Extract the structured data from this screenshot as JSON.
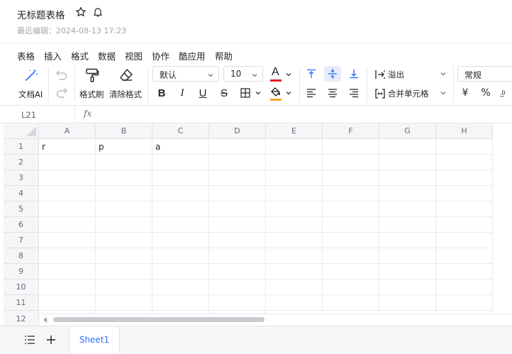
{
  "document": {
    "title": "无标题表格",
    "last_edit": "最近编辑：2024-08-13 17:23"
  },
  "menu": [
    "表格",
    "插入",
    "格式",
    "数据",
    "视图",
    "协作",
    "酷应用",
    "帮助"
  ],
  "toolbar": {
    "ai_label": "文档AI",
    "format_painter_label": "格式刷",
    "clear_format_label": "清除格式",
    "font_family": "默认",
    "font_size": "10",
    "overflow_label": "溢出",
    "merge_label": "合并单元格",
    "number_format": "常规",
    "currency_symbol": "¥",
    "percent_symbol": "%",
    "bold_glyph": "B",
    "italic_glyph": "I",
    "underline_glyph": "U",
    "strike_glyph": "S",
    "font_color_glyph": "A",
    "font_color": "#e02020",
    "fill_color": "#f5a623",
    "accent": "#3370ff"
  },
  "formula_bar": {
    "cell_ref": "L21",
    "fx": "fx"
  },
  "grid": {
    "columns": [
      "A",
      "B",
      "C",
      "D",
      "E",
      "F",
      "G",
      "H"
    ],
    "rows": [
      "1",
      "2",
      "3",
      "4",
      "5",
      "6",
      "7",
      "8",
      "9",
      "10",
      "11",
      "12"
    ],
    "cells": {
      "A1": "r",
      "B1": "p",
      "C1": "a"
    }
  },
  "sheets": [
    {
      "name": "Sheet1",
      "active": true
    }
  ]
}
